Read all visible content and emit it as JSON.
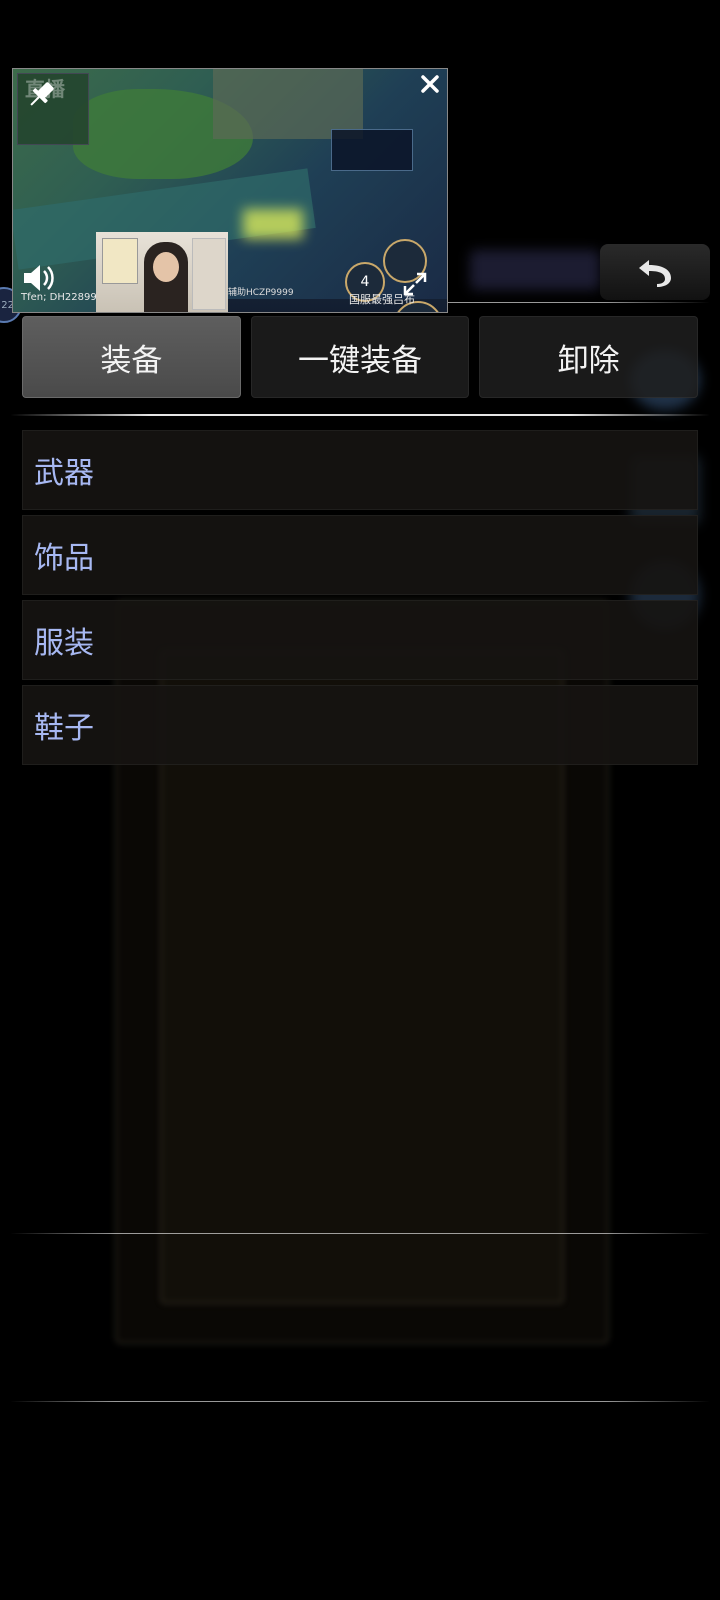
{
  "tabs": [
    {
      "label": "装备",
      "active": true
    },
    {
      "label": "一键装备",
      "active": false
    },
    {
      "label": "卸除",
      "active": false
    }
  ],
  "categories": [
    {
      "label": "武器"
    },
    {
      "label": "饰品"
    },
    {
      "label": "服装"
    },
    {
      "label": "鞋子"
    }
  ],
  "stream": {
    "caption": "Tfen; DH22899",
    "label_right": "国服最强吕布",
    "label_mid": "辅助HCZP9999",
    "watermark": "直播"
  },
  "left_badge": "22",
  "icons": {
    "back": "back-arrow-icon",
    "close": "close-icon",
    "pin": "pin-icon",
    "volume": "volume-icon",
    "expand": "expand-icon"
  },
  "colors": {
    "category_text": "#a7b8f2",
    "active_tab": "#555555",
    "background": "#000000"
  }
}
